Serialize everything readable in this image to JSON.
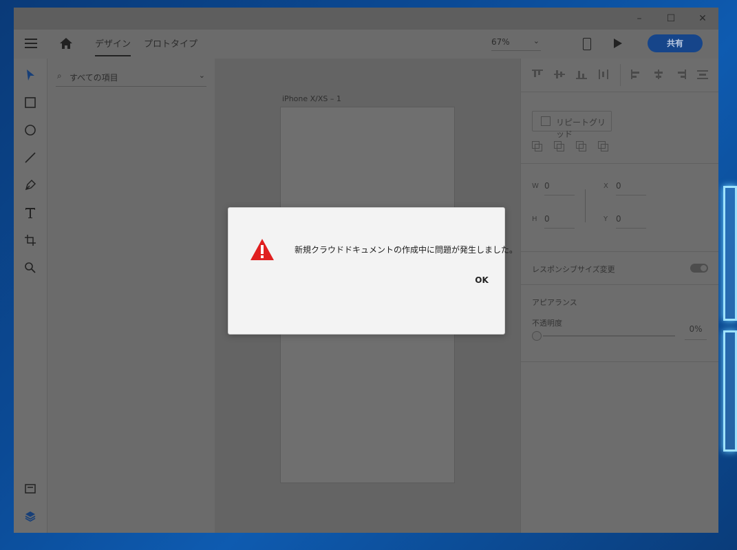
{
  "window": {
    "controls": {
      "minimize": "–",
      "maximize": "☐",
      "close": "✕"
    }
  },
  "toolbar": {
    "tabs": [
      {
        "label": "デザイン",
        "active": true
      },
      {
        "label": "プロトタイプ",
        "active": false
      }
    ],
    "zoom": "67%",
    "share_label": "共有"
  },
  "left_tools": {
    "items": [
      "select-icon",
      "rectangle-icon",
      "ellipse-icon",
      "line-icon",
      "pen-icon",
      "text-icon",
      "artboard-icon",
      "zoom-icon"
    ],
    "bottom_items": [
      "assets-icon",
      "layers-icon"
    ]
  },
  "layers_panel": {
    "search_label": "すべての項目"
  },
  "canvas": {
    "artboard_label": "iPhone X/XS – 1"
  },
  "properties": {
    "repeat_grid_label": "リピートグリッド",
    "w_label": "W",
    "w_value": "0",
    "h_label": "H",
    "h_value": "0",
    "x_label": "X",
    "x_value": "0",
    "y_label": "Y",
    "y_value": "0",
    "responsive_label": "レスポンシブサイズ変更",
    "appearance_label": "アピアランス",
    "opacity_label": "不透明度",
    "opacity_value": "0%"
  },
  "dialog": {
    "message": "新規クラウドドキュメントの作成中に問題が発生しました。",
    "ok_label": "OK"
  },
  "colors": {
    "accent": "#16458a",
    "warning": "#e02020",
    "dialog_bg": "#f3f3f3"
  }
}
